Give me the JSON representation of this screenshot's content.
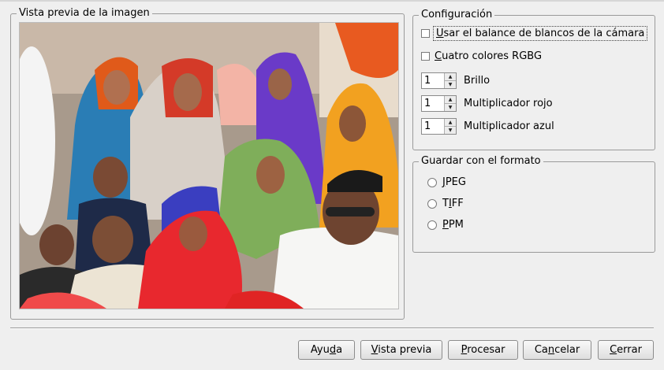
{
  "preview_group": {
    "title": "Vista previa de la imagen"
  },
  "config_group": {
    "title": "Configuración",
    "camera_white_balance": {
      "label": "Usar el balance de blancos de la cámara",
      "accel": "U",
      "checked": false
    },
    "four_color_rgbg": {
      "label": "Cuatro colores RGBG",
      "accel": "C",
      "checked": false
    },
    "brightness": {
      "value": "1",
      "label": "Brillo"
    },
    "red_multiplier": {
      "value": "1",
      "label": "Multiplicador rojo"
    },
    "blue_multiplier": {
      "value": "1",
      "label": "Multiplicador azul"
    }
  },
  "format_group": {
    "title": "Guardar con el formato",
    "options": [
      {
        "label": "JPEG",
        "accel": "J",
        "selected": false
      },
      {
        "label": "TIFF",
        "accel": "I",
        "selected": false
      },
      {
        "label": "PPM",
        "accel": "P",
        "selected": false
      }
    ]
  },
  "buttons": {
    "help": "Ayuda",
    "preview": "Vista previa",
    "process": "Procesar",
    "cancel": "Cancelar",
    "close": "Cerrar"
  }
}
